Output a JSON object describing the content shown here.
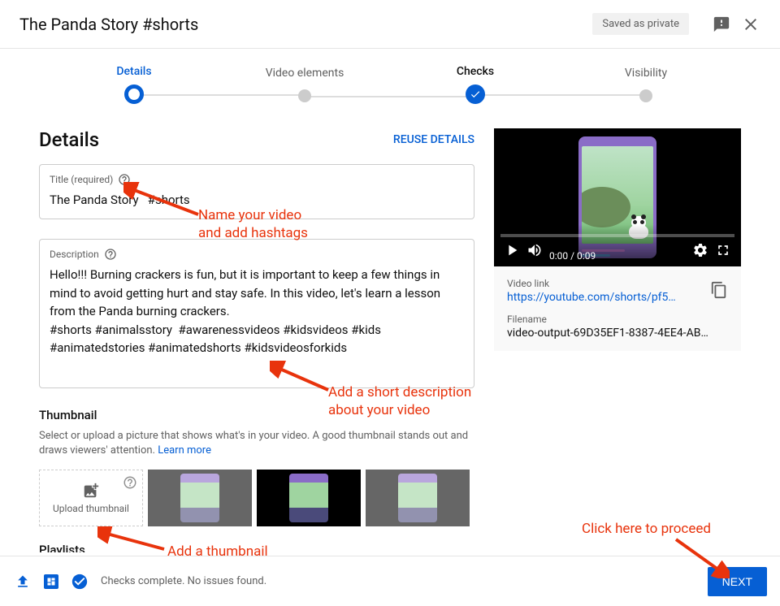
{
  "header": {
    "title": "The Panda Story #shorts",
    "saved_badge": "Saved as private"
  },
  "stepper": {
    "steps": [
      {
        "label": "Details",
        "state": "active"
      },
      {
        "label": "Video elements",
        "state": ""
      },
      {
        "label": "Checks",
        "state": "done"
      },
      {
        "label": "Visibility",
        "state": ""
      }
    ]
  },
  "details": {
    "section_title": "Details",
    "reuse_label": "REUSE DETAILS",
    "title_label": "Title (required)",
    "title_value": "The Panda Story   #shorts",
    "desc_label": "Description",
    "desc_value": "Hello!!! Burning crackers is fun, but it is important to keep a few things in mind to avoid getting hurt and stay safe. In this video, let's learn a lesson from the Panda burning crackers.\n#shorts #animalsstory  #awarenessvideos #kidsvideos #kids #animatedstories #animatedshorts #kidsvideosforkids"
  },
  "thumbnail": {
    "title": "Thumbnail",
    "desc_prefix": "Select or upload a picture that shows what's in your video. A good thumbnail stands out and draws viewers' attention. ",
    "learn_more": "Learn more",
    "upload_label": "Upload thumbnail"
  },
  "playlists": {
    "title": "Playlists"
  },
  "video": {
    "time": "0:00 / 0:09",
    "link_label": "Video link",
    "link_value": "https://youtube.com/shorts/pf5…",
    "filename_label": "Filename",
    "filename_value": "video-output-69D35EF1-8387-4EE4-AB…"
  },
  "footer": {
    "status_text": "Checks complete. No issues found.",
    "next_label": "NEXT"
  },
  "annotations": {
    "a1": "Name your video\nand add hashtags",
    "a2": "Add a short description\nabout your video",
    "a3": "Add a thumbnail",
    "a4": "Click here to proceed"
  }
}
